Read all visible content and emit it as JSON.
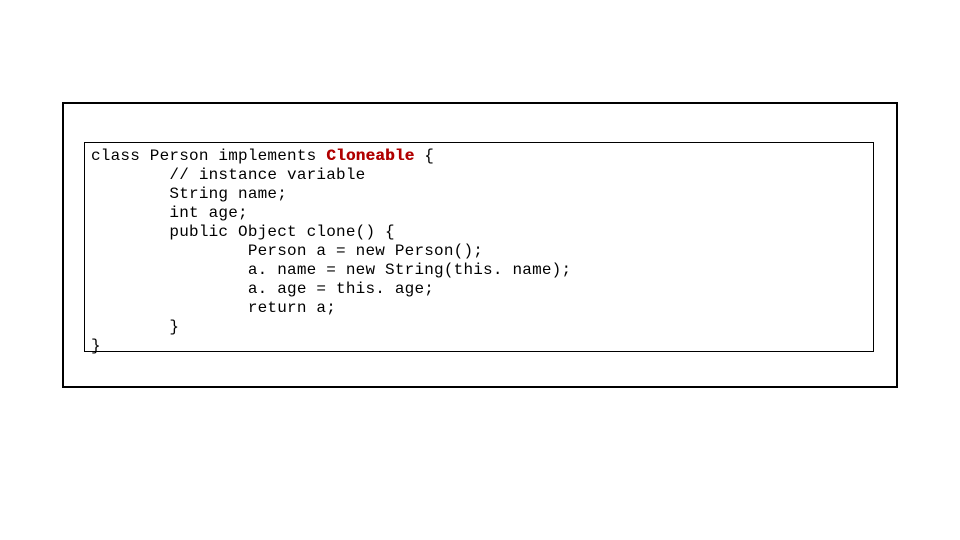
{
  "code": {
    "line1_prefix": "class Person implements ",
    "line1_red": "Cloneable",
    "line1_suffix": " {",
    "line2": "        // instance variable",
    "line3": "        String name;",
    "line4": "        int age;",
    "line5": "        public Object clone() {",
    "line6": "                Person a = new Person();",
    "line7": "                a. name = new String(this. name);",
    "line8": "                a. age = this. age;",
    "line9": "                return a;",
    "line10": "        }",
    "line11": "}"
  }
}
